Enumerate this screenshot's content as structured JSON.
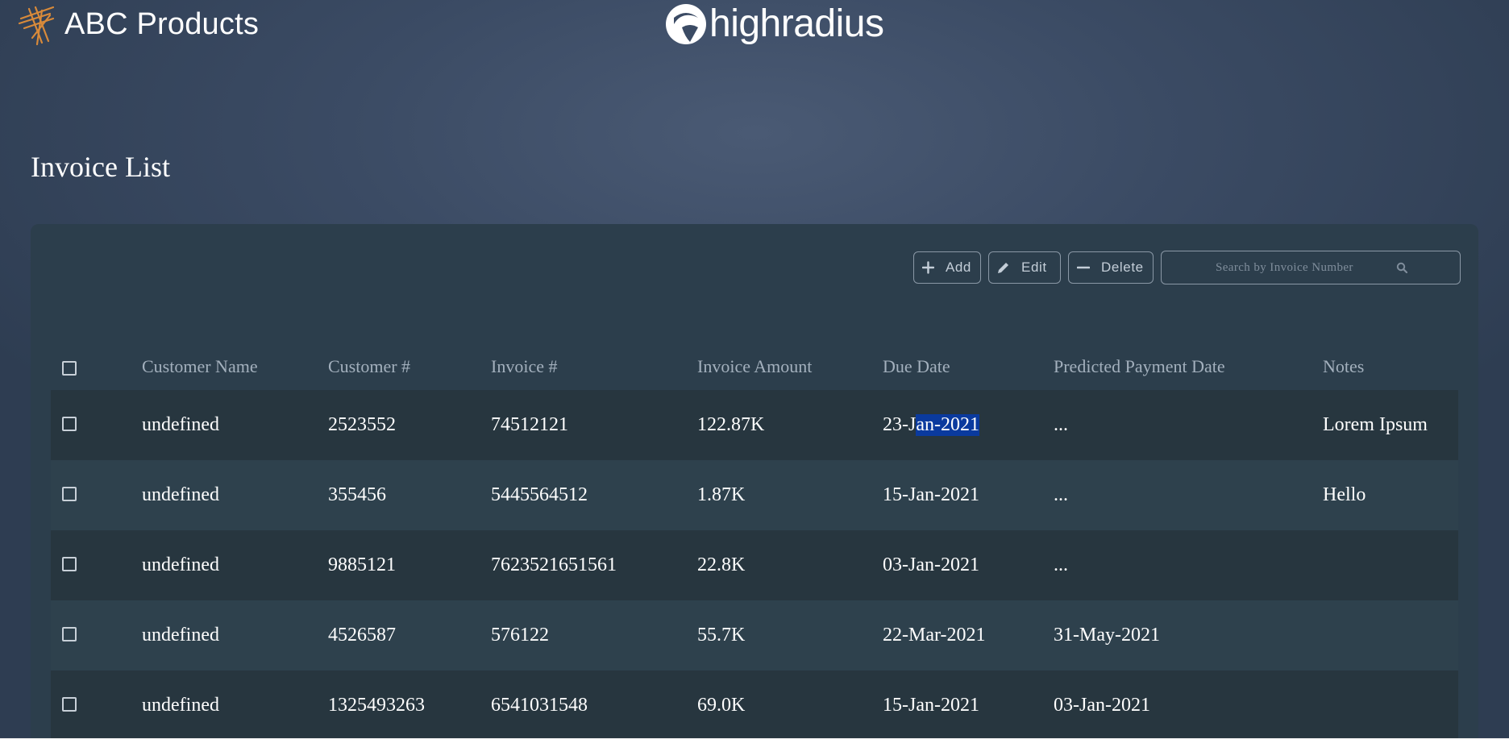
{
  "header": {
    "brand_name": "ABC Products",
    "partner_logo_text": "highradius"
  },
  "page": {
    "title": "Invoice List"
  },
  "toolbar": {
    "add_label": "Add",
    "edit_label": "Edit",
    "delete_label": "Delete",
    "search_placeholder": "Search by Invoice Number"
  },
  "table": {
    "columns": [
      "Customer Name",
      "Customer #",
      "Invoice #",
      "Invoice Amount",
      "Due Date",
      "Predicted Payment Date",
      "Notes"
    ],
    "rows": [
      {
        "customer_name": "undefined",
        "customer_no": "2523552",
        "invoice_no": "74512121",
        "amount": "122.87K",
        "due_date_a": "23-J",
        "due_date_b": "an-2021",
        "predicted": "...",
        "notes": "Lorem Ipsum"
      },
      {
        "customer_name": "undefined",
        "customer_no": "355456",
        "invoice_no": "5445564512",
        "amount": "1.87K",
        "due_date": "15-Jan-2021",
        "predicted": "...",
        "notes": "Hello"
      },
      {
        "customer_name": "undefined",
        "customer_no": "9885121",
        "invoice_no": "7623521651561",
        "amount": "22.8K",
        "due_date": "03-Jan-2021",
        "predicted": "...",
        "notes": ""
      },
      {
        "customer_name": "undefined",
        "customer_no": "4526587",
        "invoice_no": "576122",
        "amount": "55.7K",
        "due_date": "22-Mar-2021",
        "predicted": "31-May-2021",
        "notes": ""
      },
      {
        "customer_name": "undefined",
        "customer_no": "1325493263",
        "invoice_no": "6541031548",
        "amount": "69.0K",
        "due_date": "15-Jan-2021",
        "predicted": "03-Jan-2021",
        "notes": ""
      }
    ]
  },
  "colors": {
    "background": "#3b4b64",
    "card": "#2c3e4c",
    "row_dark": "#27363f",
    "row_light": "#2e414d",
    "brand_accent": "#d88a3a",
    "selection": "#0a3a9e"
  },
  "icons": [
    "abc-brand-logo-icon",
    "highradius-logo-icon",
    "plus-icon",
    "pencil-icon",
    "minus-icon",
    "search-icon",
    "checkbox-icon"
  ]
}
